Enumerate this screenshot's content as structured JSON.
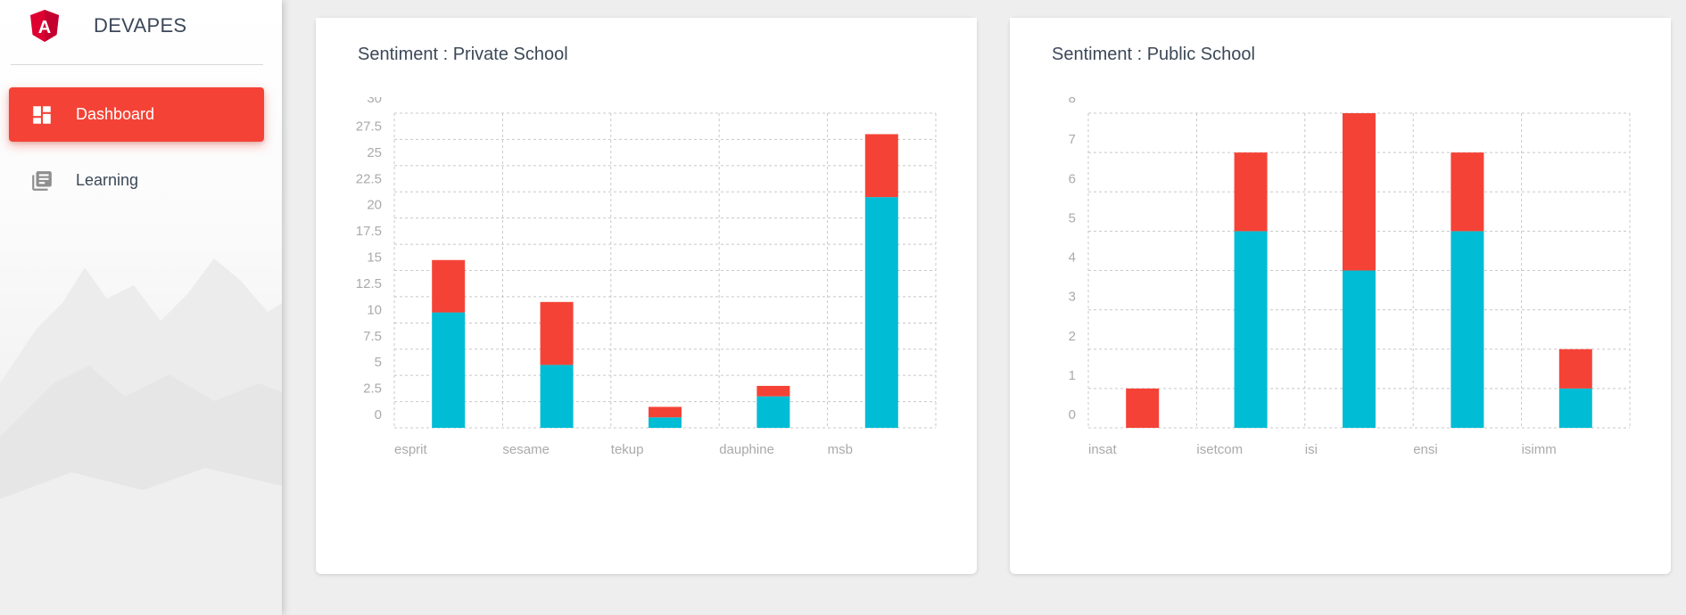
{
  "app": {
    "brand": "DEVAPES",
    "logo_letter": "A",
    "logo_color": "#dd0031"
  },
  "sidebar": {
    "items": [
      {
        "label": "Dashboard",
        "icon": "dashboard-icon",
        "active": true
      },
      {
        "label": "Learning",
        "icon": "library-books-icon",
        "active": false
      }
    ]
  },
  "colors": {
    "accent": "#f44336",
    "series_cyan": "#00bcd4",
    "series_red": "#f44336"
  },
  "cards": [
    {
      "title": "Sentiment : Private School"
    },
    {
      "title": "Sentiment : Public School"
    }
  ],
  "chart_data": [
    {
      "type": "bar",
      "stacked": true,
      "categories": [
        "esprit",
        "sesame",
        "tekup",
        "dauphine",
        "msb"
      ],
      "series": [
        {
          "color": "#00bcd4",
          "values": [
            11,
            6,
            1,
            3,
            22
          ]
        },
        {
          "color": "#f44336",
          "values": [
            5,
            6,
            1,
            1,
            6
          ]
        }
      ],
      "yticks": [
        "0",
        "2.5",
        "5",
        "7.5",
        "10",
        "12.5",
        "15",
        "17.5",
        "20",
        "22.5",
        "25",
        "27.5",
        "30"
      ],
      "ylim": [
        0,
        30
      ],
      "grid": true
    },
    {
      "type": "bar",
      "stacked": true,
      "categories": [
        "insat",
        "isetcom",
        "isi",
        "ensi",
        "isimm"
      ],
      "series": [
        {
          "color": "#00bcd4",
          "values": [
            0,
            5,
            4,
            5,
            1
          ]
        },
        {
          "color": "#f44336",
          "values": [
            1,
            2,
            4,
            2,
            1
          ]
        }
      ],
      "yticks": [
        "0",
        "1",
        "2",
        "3",
        "4",
        "5",
        "6",
        "7",
        "8"
      ],
      "ylim": [
        0,
        8
      ],
      "grid": true
    }
  ]
}
